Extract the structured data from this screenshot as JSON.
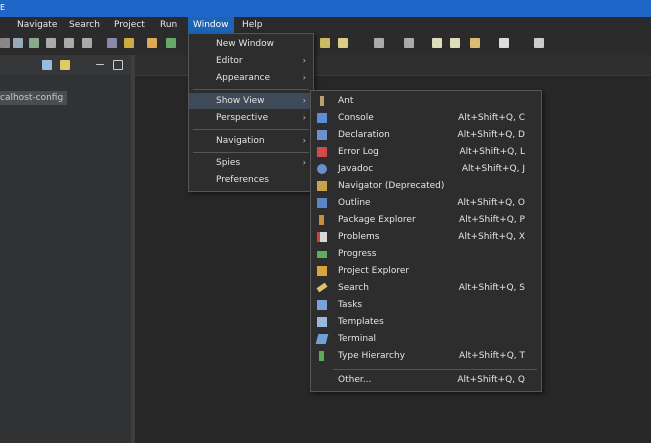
{
  "titlebar": {
    "glyph": "E"
  },
  "menubar": {
    "items": [
      {
        "label": "Navigate"
      },
      {
        "label": "Search"
      },
      {
        "label": "Project"
      },
      {
        "label": "Run"
      },
      {
        "label": "Window"
      },
      {
        "label": "Help"
      }
    ]
  },
  "left_panel": {
    "project_item": "calhost-config"
  },
  "window_menu": {
    "items": [
      {
        "label": "New Window"
      },
      {
        "label": "Editor"
      },
      {
        "label": "Appearance"
      },
      {
        "label": "Show View"
      },
      {
        "label": "Perspective"
      },
      {
        "label": "Navigation"
      },
      {
        "label": "Spies"
      },
      {
        "label": "Preferences"
      }
    ]
  },
  "show_view_menu": {
    "items": [
      {
        "label": "Ant",
        "shortcut": "",
        "icon": "ant-icon"
      },
      {
        "label": "Console",
        "shortcut": "Alt+Shift+Q, C",
        "icon": "console-icon"
      },
      {
        "label": "Declaration",
        "shortcut": "Alt+Shift+Q, D",
        "icon": "declaration-icon"
      },
      {
        "label": "Error Log",
        "shortcut": "Alt+Shift+Q, L",
        "icon": "error-log-icon"
      },
      {
        "label": "Javadoc",
        "shortcut": "Alt+Shift+Q, J",
        "icon": "javadoc-icon"
      },
      {
        "label": "Navigator (Deprecated)",
        "shortcut": "",
        "icon": "navigator-icon"
      },
      {
        "label": "Outline",
        "shortcut": "Alt+Shift+Q, O",
        "icon": "outline-icon"
      },
      {
        "label": "Package Explorer",
        "shortcut": "Alt+Shift+Q, P",
        "icon": "package-explorer-icon"
      },
      {
        "label": "Problems",
        "shortcut": "Alt+Shift+Q, X",
        "icon": "problems-icon"
      },
      {
        "label": "Progress",
        "shortcut": "",
        "icon": "progress-icon"
      },
      {
        "label": "Project Explorer",
        "shortcut": "",
        "icon": "project-explorer-icon"
      },
      {
        "label": "Search",
        "shortcut": "Alt+Shift+Q, S",
        "icon": "search-icon"
      },
      {
        "label": "Tasks",
        "shortcut": "",
        "icon": "tasks-icon"
      },
      {
        "label": "Templates",
        "shortcut": "",
        "icon": "templates-icon"
      },
      {
        "label": "Terminal",
        "shortcut": "",
        "icon": "terminal-icon"
      },
      {
        "label": "Type Hierarchy",
        "shortcut": "Alt+Shift+Q, T",
        "icon": "type-hierarchy-icon"
      },
      {
        "label": "Other...",
        "shortcut": "Alt+Shift+Q, Q",
        "icon": ""
      }
    ]
  },
  "colors": {
    "accent": "#1f63b4",
    "selection": "#3e4a57",
    "menu_bg": "#2d2d2d"
  }
}
